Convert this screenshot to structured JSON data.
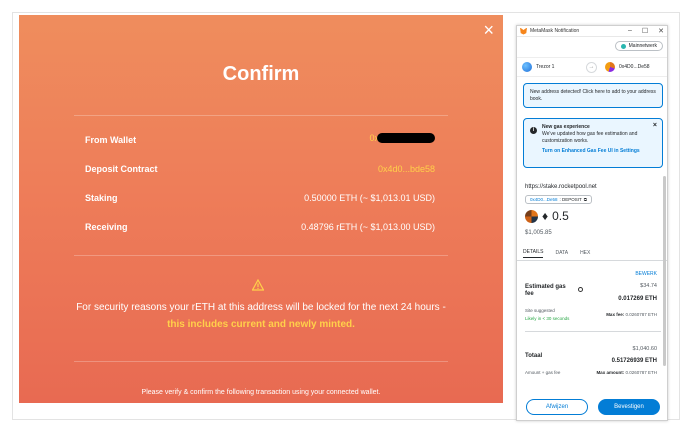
{
  "modal": {
    "close_glyph": "×",
    "title": "Confirm",
    "rows": [
      {
        "label": "From Wallet",
        "value": "0x"
      },
      {
        "label": "Deposit Contract",
        "value": "0x4d0...bde58"
      },
      {
        "label": "Staking",
        "value": "0.50000 ETH (~ $1,013.01 USD)"
      },
      {
        "label": "Receiving",
        "value": "0.48796 rETH (~ $1,013.00 USD)"
      }
    ],
    "notice_text": "For security reasons your rETH at this address will be locked for the next 24 hours - ",
    "notice_highlight": "this includes current and newly minted.",
    "footnote": "Please verify & confirm the following transaction using your connected wallet.",
    "colors": {
      "accent": "#ffd04a",
      "bg_top": "#ef8d5d",
      "bg_bottom": "#e86a52"
    }
  },
  "metamask": {
    "window_title": "MetaMask Notification",
    "window_controls": [
      "–",
      "☐",
      "✕"
    ],
    "network": "Mainnetwerk",
    "from_account": "Trezor 1",
    "to_account": "0x4D0...De58",
    "new_address_notice": "New address detected! Click here to add to your address book.",
    "gas_box": {
      "title": "New gas experience",
      "body": "We've updated how gas fee estimation and customization works.",
      "link": "Turn on Enhanced Gas Fee UI in Settings"
    },
    "site": "https://stake.rocketpool.net",
    "tag_address": "0x4D0...De58",
    "tag_action": ": DEPOSIT",
    "amount": "0.5",
    "amount_symbol": "♦",
    "amount_usd": "$1,005.85",
    "tabs": [
      "DETAILS",
      "DATA",
      "HEX"
    ],
    "edit_label": "BEWERK",
    "estimated_gas_label": "Estimated gas fee",
    "gas_usd": "$34.74",
    "gas_eth": "0.017269 ETH",
    "site_suggested": "Site suggested",
    "likely": "Likely in < 30 seconds",
    "max_fee_label": "Max fee:",
    "max_fee_value": "0.0260787 ETH",
    "total_label": "Totaal",
    "total_usd": "$1,040.60",
    "total_eth": "0.51726939 ETH",
    "amount_gas_label": "Amount + gas fee",
    "max_amount_label": "Max amount:",
    "max_amount_value": "0.0260787 ETH",
    "reject_label": "Afwijzen",
    "confirm_label": "Bevestigen",
    "colors": {
      "primary": "#037dd6",
      "success": "#28a745"
    }
  }
}
